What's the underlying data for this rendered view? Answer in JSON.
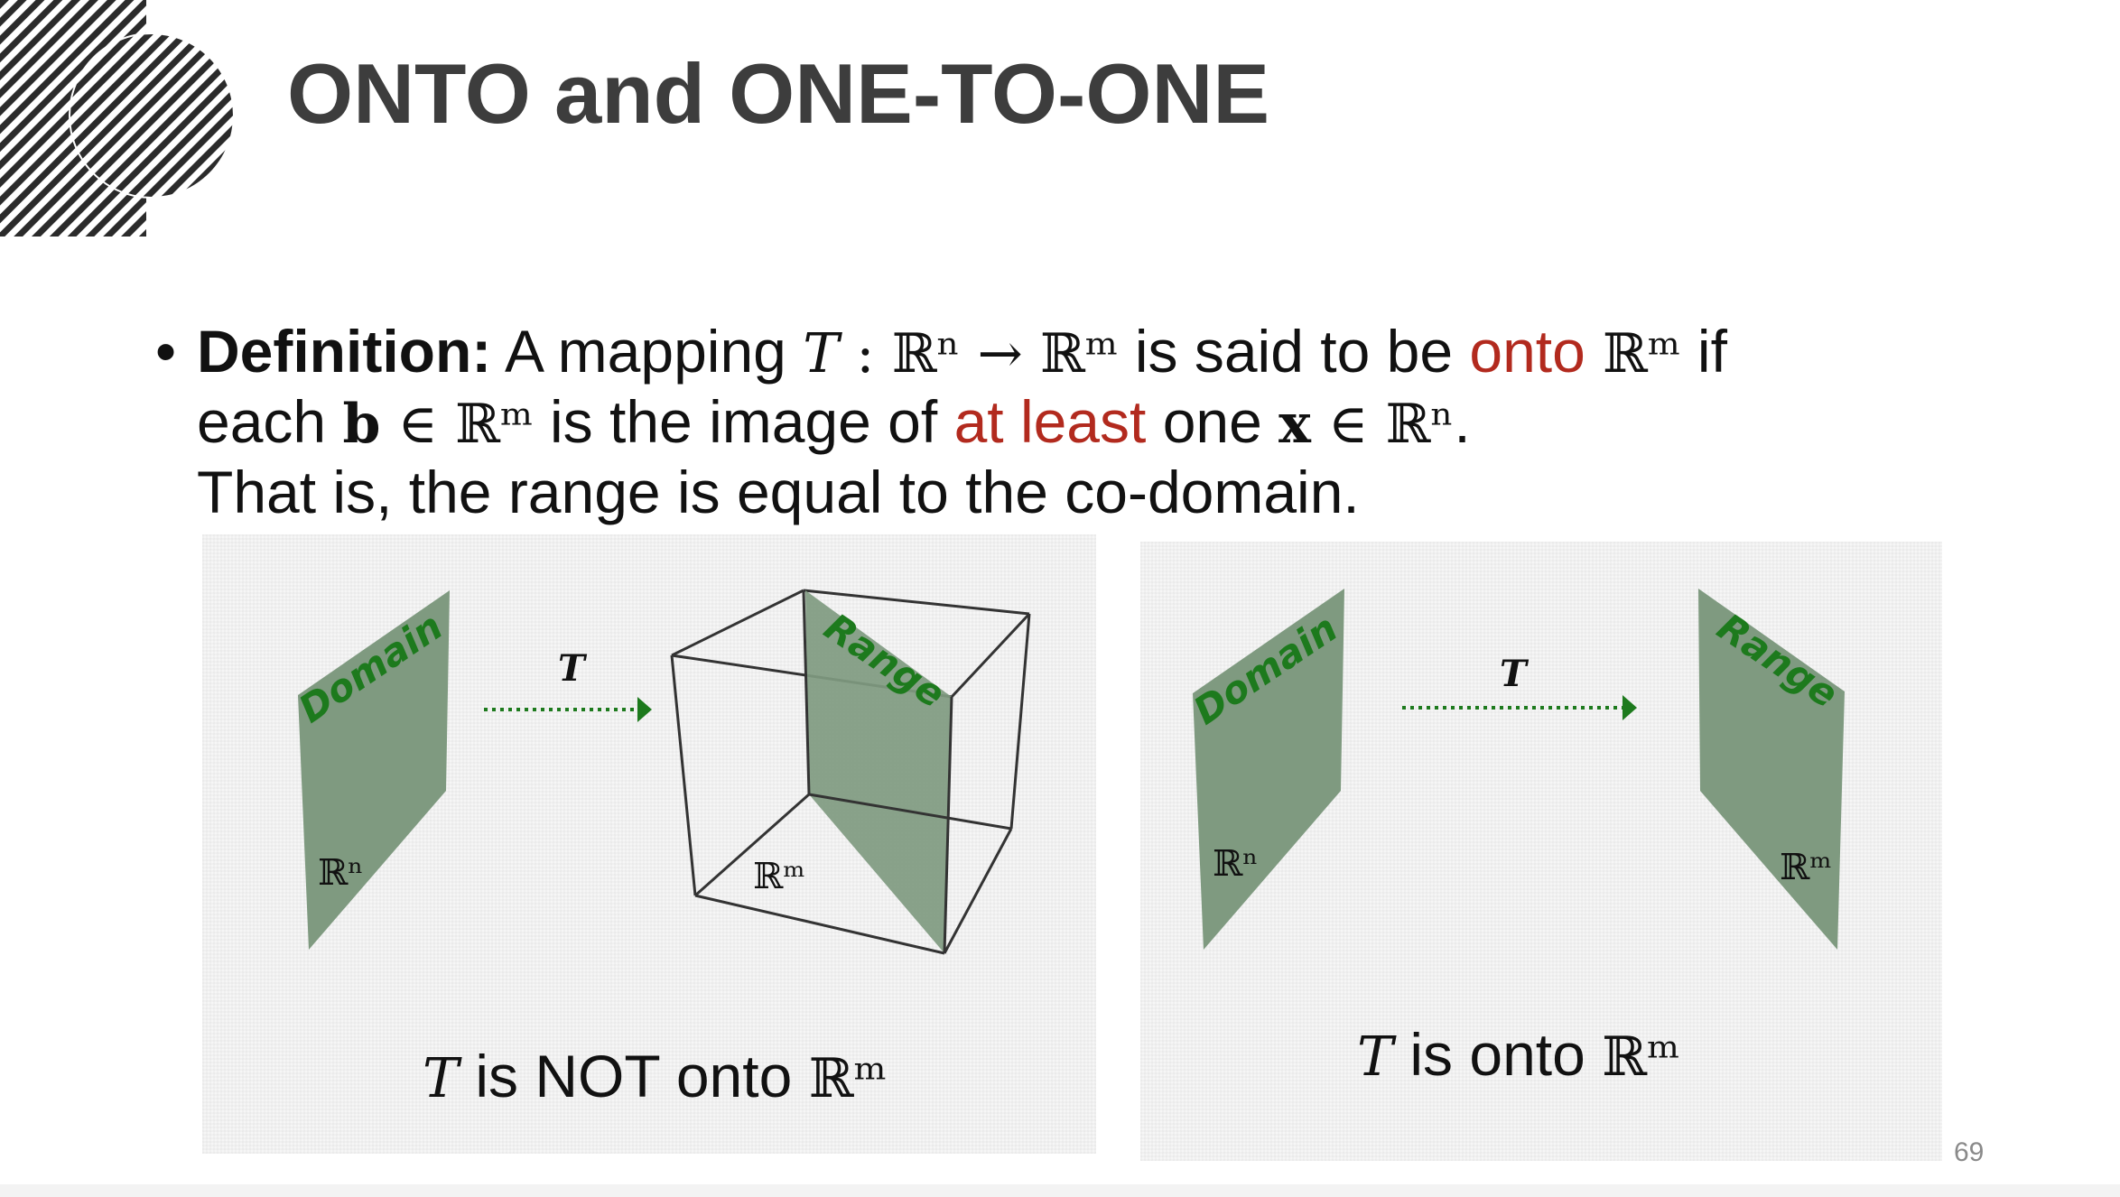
{
  "slide": {
    "title": "ONTO and ONE-TO-ONE",
    "page_number": "69",
    "accent_color": "#b22a1e",
    "plane_color": "#7f9a80",
    "label_color": "#1d7a1d",
    "arrow_color": "#1d7a1d"
  },
  "definition": {
    "bullet": "•",
    "term": "Definition:",
    "t1": " A mapping ",
    "m_T": "T",
    "m_colon": " : ",
    "m_Rn": "ℝⁿ",
    "m_arrow": " → ",
    "m_Rm": "ℝᵐ",
    "t2": " is said to be ",
    "onto": "onto",
    "m_Rm2": " ℝᵐ",
    "t3": " if",
    "t4": "each ",
    "m_b": "b",
    "m_in": " ∈ ",
    "m_Rm3": "ℝᵐ",
    "t5": " is the image of ",
    "at_least": "at least",
    "t6": " one ",
    "m_x": "x",
    "m_in2": " ∈ ",
    "m_Rn2": "ℝⁿ",
    "t7": ".",
    "line3": "That is, the range is equal to the co-domain."
  },
  "diagram_left": {
    "domain_label": "Domain",
    "domain_space": "ℝⁿ",
    "arrow_label": "T",
    "range_label": "Range",
    "codomain_space": "ℝᵐ",
    "caption_T": "T",
    "caption_text": " is NOT onto ",
    "caption_space": "ℝᵐ"
  },
  "diagram_right": {
    "domain_label": "Domain",
    "domain_space": "ℝⁿ",
    "arrow_label": "T",
    "range_label": "Range",
    "range_space": "ℝᵐ",
    "caption_T": "T",
    "caption_text": " is onto ",
    "caption_space": "ℝᵐ"
  }
}
